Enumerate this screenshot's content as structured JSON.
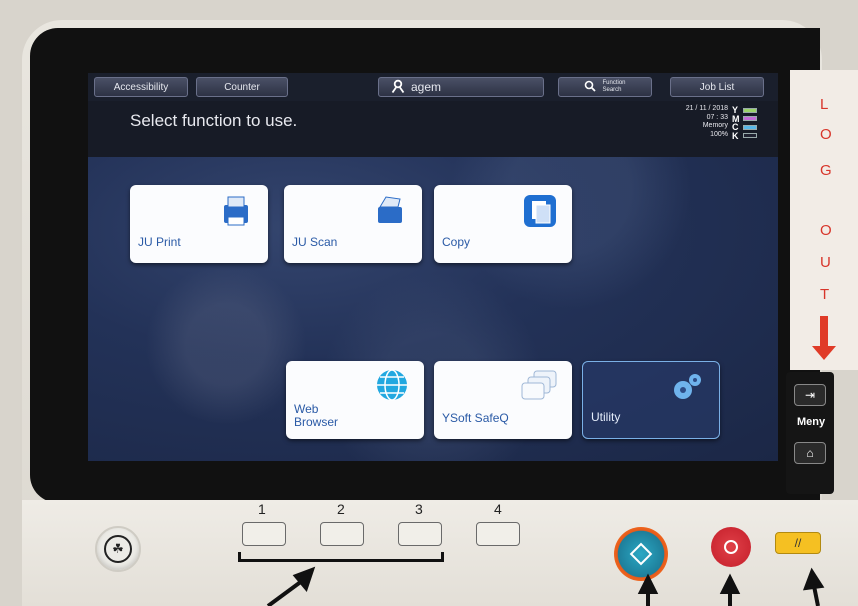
{
  "topbar": {
    "accessibility": "Accessibility",
    "counter": "Counter",
    "user": "agem",
    "function_search_line1": "Function",
    "function_search_line2": "Search",
    "job_list": "Job List"
  },
  "header": {
    "title": "Select function to use."
  },
  "status": {
    "date": "21 / 11 / 2018",
    "time": "07 : 33",
    "memory_label": "Memory",
    "memory_value": "100%",
    "toner": [
      {
        "letter": "Y",
        "color": "#9bd36a"
      },
      {
        "letter": "M",
        "color": "#c26bd6"
      },
      {
        "letter": "C",
        "color": "#58b6e6"
      },
      {
        "letter": "K",
        "color": "#1f2230"
      }
    ]
  },
  "tiles": {
    "ju_print": "JU Print",
    "ju_scan": "JU Scan",
    "copy": "Copy",
    "web_browser_line1": "Web",
    "web_browser_line2": "Browser",
    "ysoft": "YSoft SafeQ",
    "utility": "Utility"
  },
  "logout_sign": {
    "letters": [
      "L",
      "O",
      "G",
      "O",
      "U",
      "T"
    ]
  },
  "side_panel": {
    "meny": "Meny"
  },
  "keypad": {
    "labels": [
      "1",
      "2",
      "3",
      "4"
    ]
  }
}
